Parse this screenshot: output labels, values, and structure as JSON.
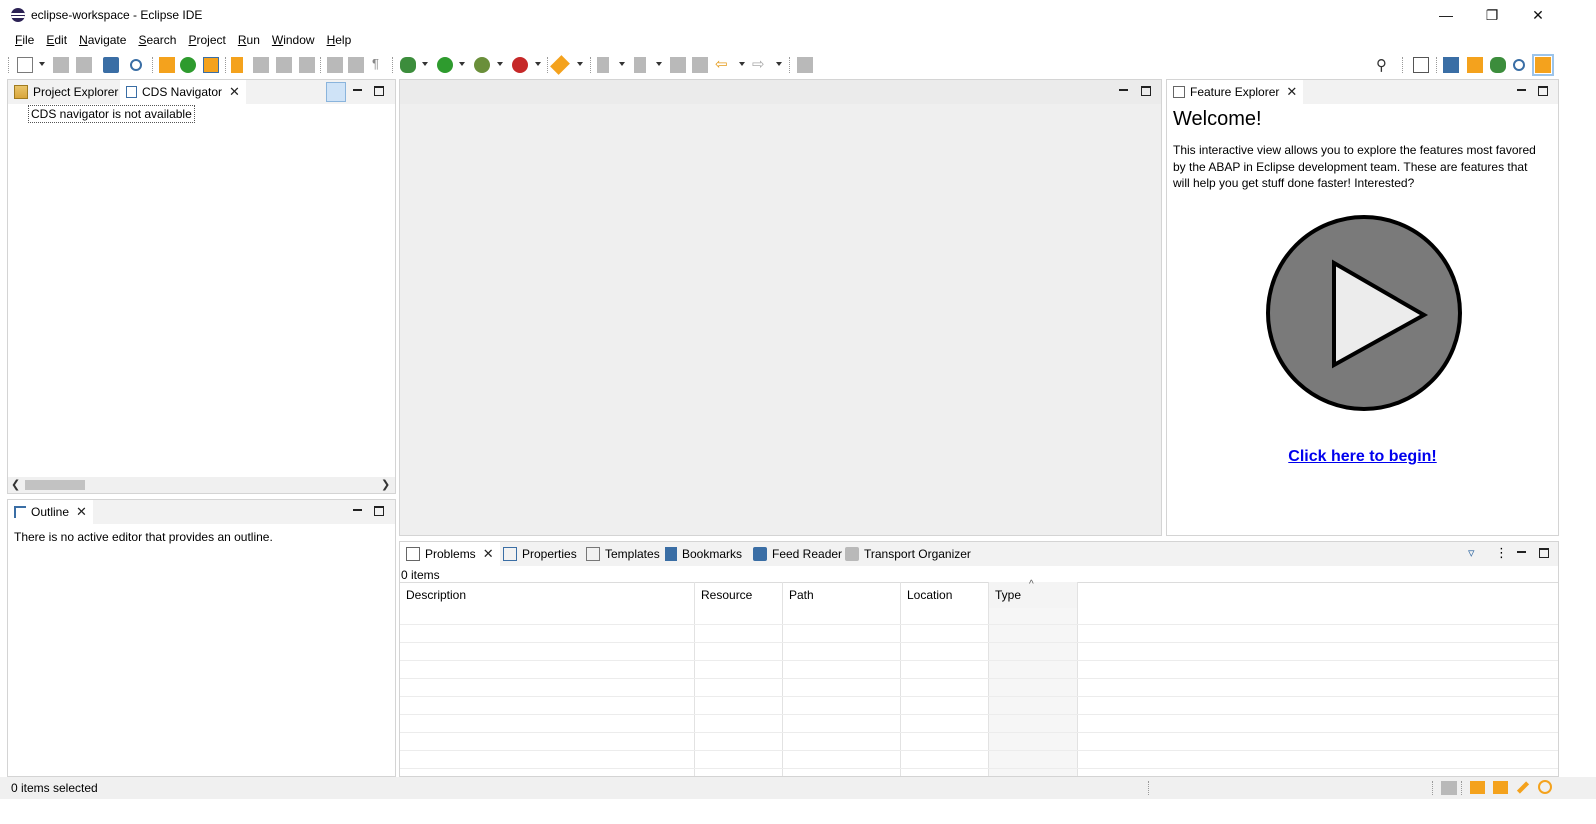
{
  "window": {
    "title": "eclipse-workspace - Eclipse IDE",
    "controls": {
      "minimize": "—",
      "restore": "❐",
      "close": "✕"
    }
  },
  "menu": [
    {
      "label": "File",
      "mnemonic": "F",
      "rest": "ile"
    },
    {
      "label": "Edit",
      "mnemonic": "E",
      "rest": "dit"
    },
    {
      "label": "Navigate",
      "mnemonic": "N",
      "rest": "avigate"
    },
    {
      "label": "Search",
      "mnemonic": "S",
      "rest": "earch"
    },
    {
      "label": "Project",
      "mnemonic": "P",
      "rest": "roject"
    },
    {
      "label": "Run",
      "mnemonic": "R",
      "rest": "un"
    },
    {
      "label": "Window",
      "mnemonic": "W",
      "rest": "indow"
    },
    {
      "label": "Help",
      "mnemonic": "H",
      "rest": "elp"
    }
  ],
  "left_top": {
    "tabs": [
      {
        "label": "Project Explorer",
        "icon": "project-explorer-icon"
      },
      {
        "label": "CDS Navigator",
        "icon": "cds-navigator-icon",
        "active": true
      }
    ],
    "message": "CDS navigator is not available"
  },
  "outline": {
    "tab": "Outline",
    "message": "There is no active editor that provides an outline."
  },
  "feature_explorer": {
    "tab": "Feature Explorer",
    "heading": "Welcome!",
    "body": "This interactive view allows you to explore the features most favored by the ABAP in Eclipse development team. These are features that will help you get stuff done faster! Interested?",
    "link": "Click here to begin!",
    "link_color": "#0000ee",
    "play_icon": "play-button-icon"
  },
  "bottom_panel": {
    "tabs": [
      {
        "label": "Problems",
        "icon": "problems-icon",
        "active": true
      },
      {
        "label": "Properties",
        "icon": "properties-icon"
      },
      {
        "label": "Templates",
        "icon": "templates-icon"
      },
      {
        "label": "Bookmarks",
        "icon": "bookmarks-icon"
      },
      {
        "label": "Feed Reader",
        "icon": "feed-reader-icon"
      },
      {
        "label": "Transport Organizer",
        "icon": "transport-organizer-icon"
      }
    ],
    "count": "0 items",
    "columns": [
      "Description",
      "Resource",
      "Path",
      "Location",
      "Type"
    ],
    "sort_indicator": "^"
  },
  "status": {
    "text": "0 items selected"
  },
  "colors": {
    "pane_border": "#d4d4d4",
    "tab_strip": "#f2f2f2",
    "editor_bg": "#efefef",
    "accent_blue": "#0000ee"
  }
}
